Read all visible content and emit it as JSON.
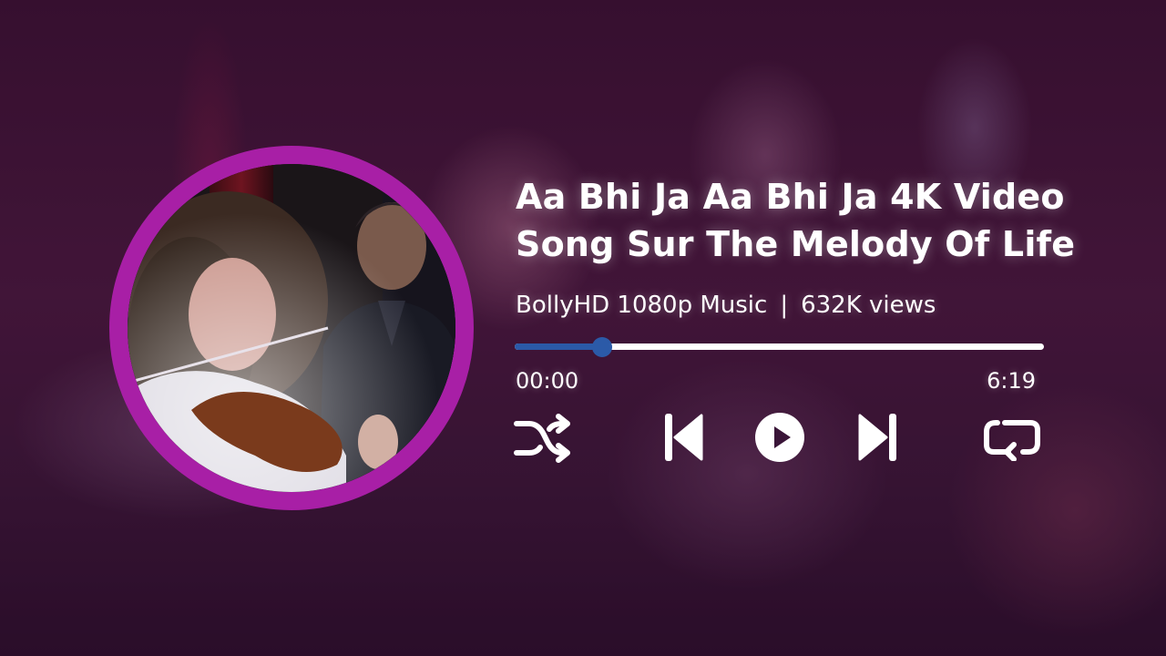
{
  "track": {
    "title": "Aa Bhi Ja Aa Bhi Ja 4K Video Song Sur The Melody Of Life",
    "channel": "BollyHD 1080p Music",
    "separator": "|",
    "views": "632K views"
  },
  "playback": {
    "current_time": "00:00",
    "total_time": "6:19",
    "progress_fraction": 0.165
  },
  "controls": {
    "shuffle_icon": "shuffle-icon",
    "previous_icon": "skip-previous-icon",
    "play_icon": "play-icon",
    "next_icon": "skip-next-icon",
    "repeat_icon": "repeat-icon"
  },
  "colors": {
    "accent_ring": "#a81fa6",
    "progress_fill": "#2b5aa8",
    "progress_track": "#ffffff",
    "text": "#ffffff"
  }
}
